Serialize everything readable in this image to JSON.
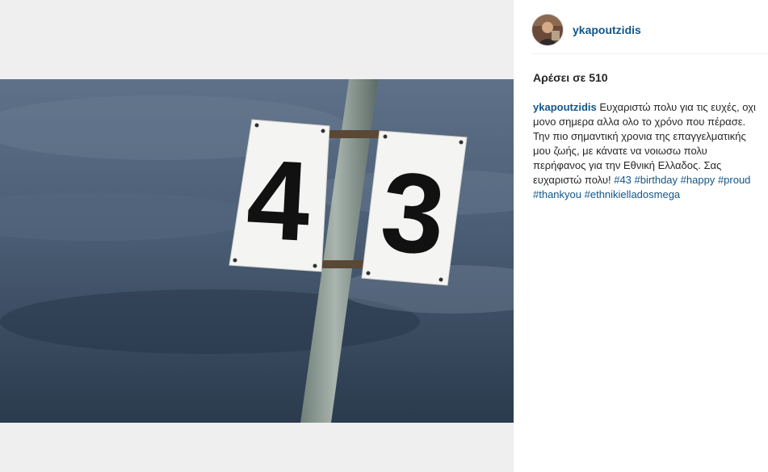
{
  "post": {
    "username": "ykapoutzidis",
    "likes_text": "Αρέσει σε 510",
    "caption": {
      "username": "ykapoutzidis",
      "text": "Ευχαριστώ πολυ για τις ευχές, οχι μονο σημερα αλλα ολο το χρόνο που πέρασε. Την πιο σημαντική χρονια της επαγγελματικής μου ζωής, με κάνατε να νοιωσω πολυ περήφανος για την Εθνική Ελλαδος. Σας ευχαριστώ πολυ!",
      "hashtags": [
        "#43",
        "#birthday",
        "#happy",
        "#proud",
        "#thankyou",
        "#ethnikielladosmega"
      ]
    }
  },
  "photo": {
    "left_sign": "4",
    "right_sign": "3"
  },
  "icons": {
    "avatar": "user-avatar"
  },
  "colors": {
    "link": "#125688",
    "text": "#262626",
    "media_bg": "#efefef"
  }
}
